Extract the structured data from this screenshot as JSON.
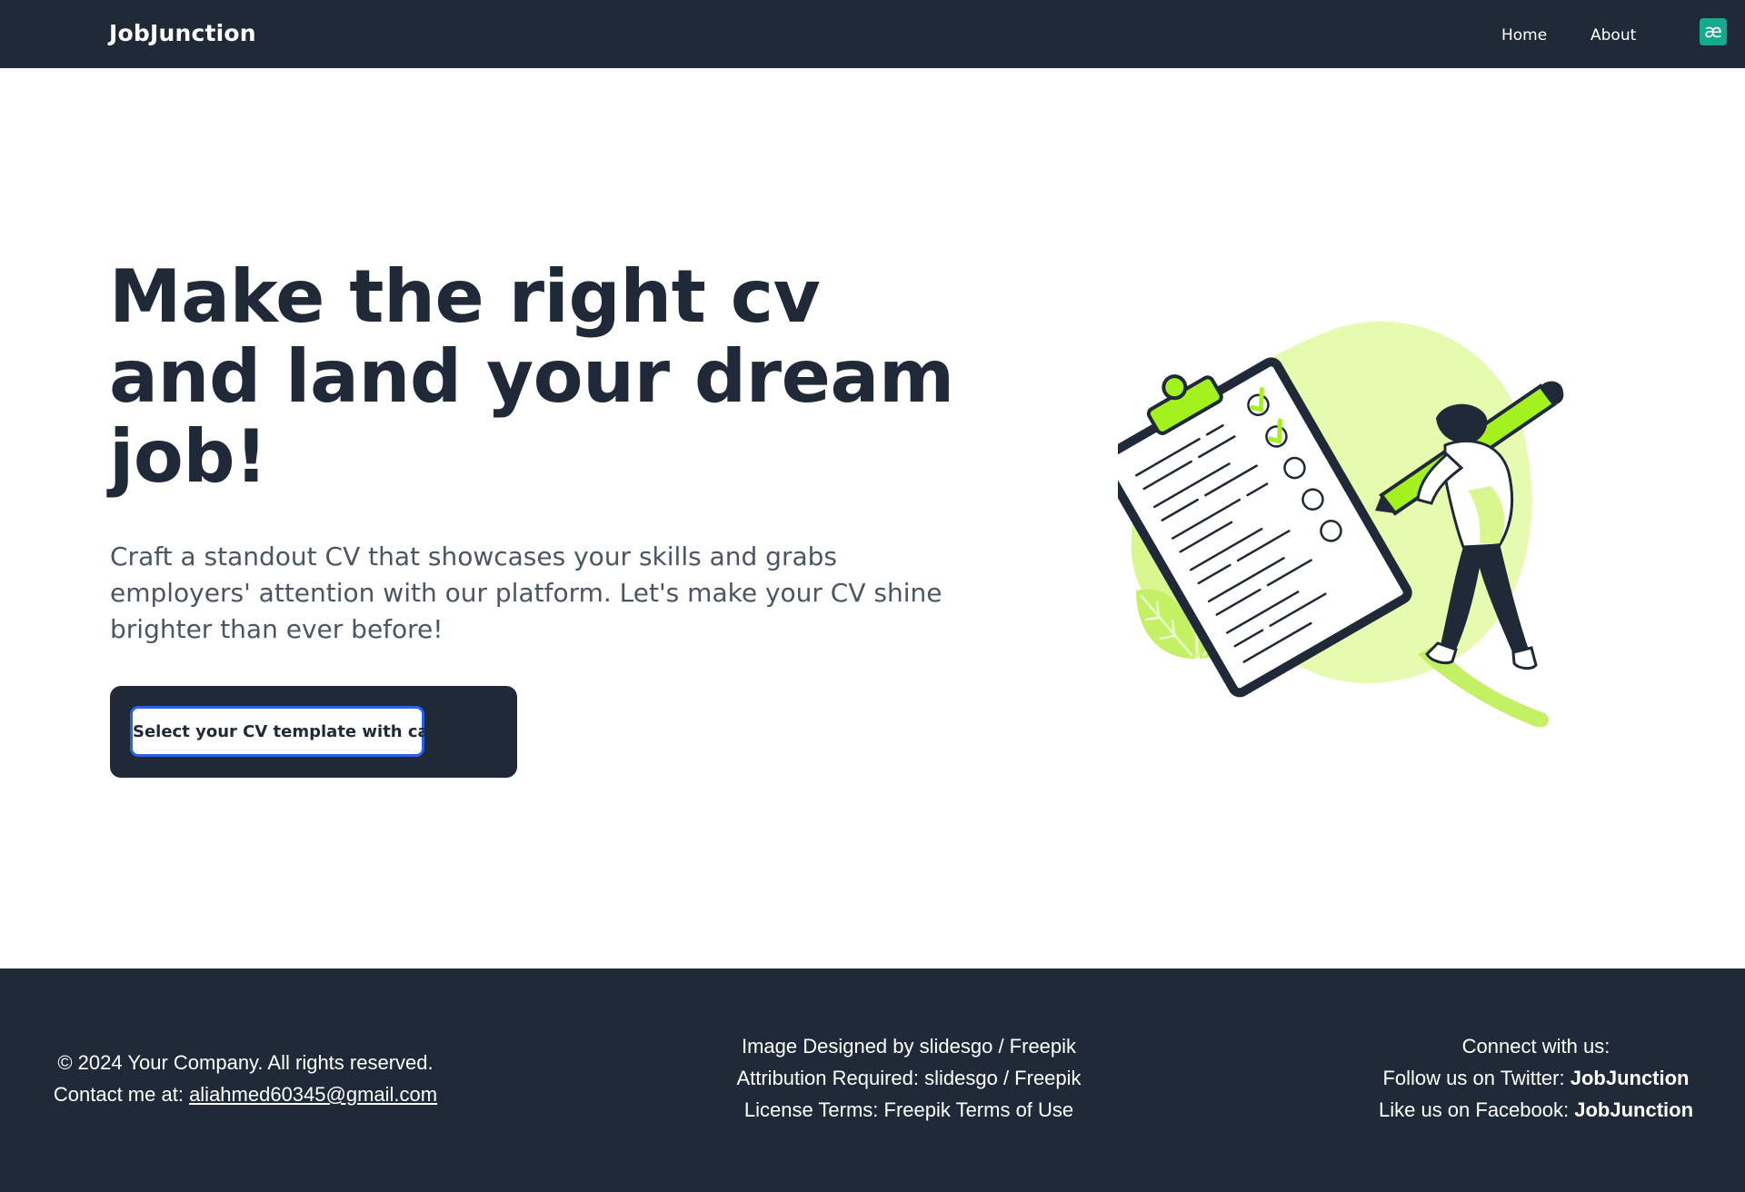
{
  "header": {
    "brand": "JobJunction",
    "nav": {
      "home": "Home",
      "about": "About"
    },
    "extension_badge": "æ"
  },
  "hero": {
    "title_line1": "Make the right cv",
    "title_line2": "and land your dream",
    "title_line3": "job!",
    "subtitle": "Craft a standout CV that showcases your skills and grabs employers' attention with our platform. Let's make your CV shine brighter than ever before!",
    "cta_label": "Select your CV template with care →"
  },
  "illustration": {
    "icon": "person-writing-on-clipboard-illustration",
    "accent_color": "#a3f21d",
    "blob_color": "#e6fbb0"
  },
  "footer": {
    "copyright": "© 2024 Your Company. All rights reserved.",
    "contact_prefix": "Contact me at: ",
    "contact_email": "aliahmed60345@gmail.com",
    "credit_line1": "Image Designed by slidesgo / Freepik",
    "credit_line2": "Attribution Required: slidesgo / Freepik",
    "credit_line3": "License Terms: Freepik Terms of Use",
    "connect_heading": "Connect with us:",
    "twitter_prefix": "Follow us on Twitter: ",
    "twitter_handle": "JobJunction",
    "facebook_prefix": "Like us on Facebook: ",
    "facebook_handle": "JobJunction"
  },
  "colors": {
    "navy": "#1f2937",
    "accent_green": "#a3f21d",
    "focus_blue": "#2563eb",
    "badge_teal": "#16a98f"
  }
}
